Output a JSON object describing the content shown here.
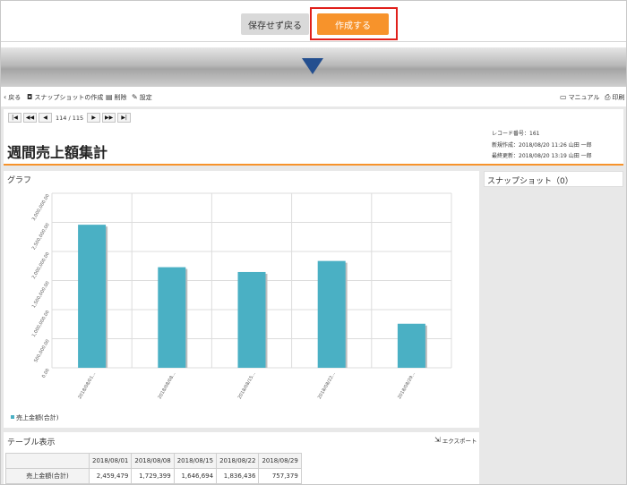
{
  "topbar": {
    "back_label": "保存せず戻る",
    "create_label": "作成する"
  },
  "toolbar": {
    "back": "戻る",
    "create_snapshot": "スナップショットの作成",
    "delete": "削除",
    "settings": "設定",
    "manual": "マニュアル",
    "print": "印刷"
  },
  "pager": {
    "position": "114 / 115"
  },
  "record": {
    "title": "週間売上額集計",
    "record_no": "レコード番号：161",
    "created": "新規作成：2018/08/20 11:26 山田 一郎",
    "updated": "最終更新：2018/08/20 13:19 山田 一郎"
  },
  "graph": {
    "title": "グラフ"
  },
  "snapshot": {
    "title": "スナップショット（0）"
  },
  "table": {
    "title": "テーブル表示",
    "export_label": "エクスポート",
    "columns": [
      "2018/08/01",
      "2018/08/08",
      "2018/08/15",
      "2018/08/22",
      "2018/08/29"
    ],
    "row_label": "売上金額(合計)",
    "values": [
      "2,459,479",
      "1,729,399",
      "1,646,694",
      "1,836,436",
      "757,379"
    ]
  },
  "colors": {
    "accent": "#f7932b",
    "highlight_border": "#e0201b",
    "bar": "#4ab0c4",
    "arrow": "#244f8f"
  },
  "chart_data": {
    "type": "bar",
    "categories": [
      "2018/08/01...",
      "2018/08/08...",
      "2018/08/15...",
      "2018/08/22...",
      "2018/08/29..."
    ],
    "series": [
      {
        "name": "売上金額(合計)",
        "values": [
          2459479,
          1729399,
          1646694,
          1836436,
          757379
        ]
      }
    ],
    "yticks": [
      "0.00",
      "500,000.00",
      "1,000,000.00",
      "1,500,000.00",
      "2,000,000.00",
      "2,500,000.00",
      "3,000,000.00"
    ],
    "ylim": [
      0,
      3000000
    ],
    "grid": true,
    "legend": "bottom-left"
  }
}
